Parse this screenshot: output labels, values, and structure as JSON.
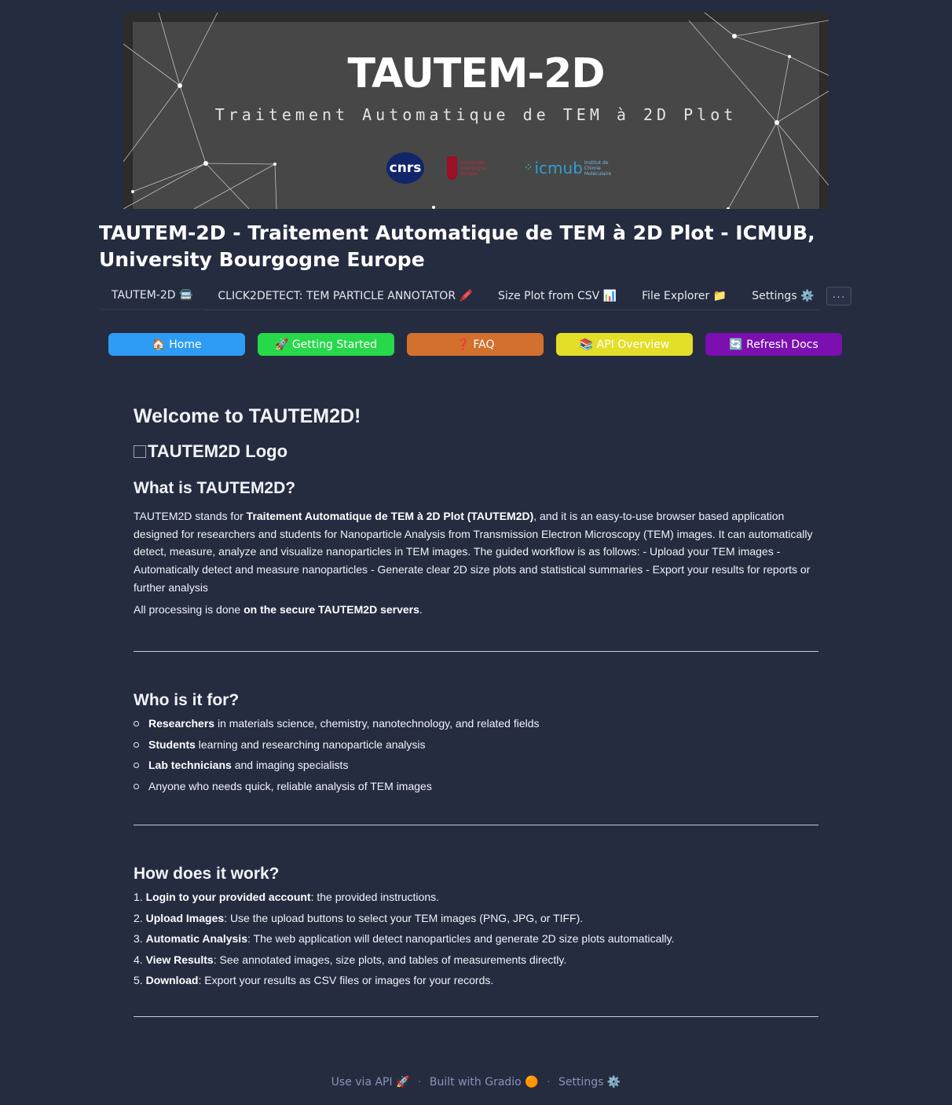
{
  "banner": {
    "title": "TAUTEM-2D",
    "subtitle": "Traitement Automatique de TEM à 2D Plot",
    "logos": {
      "cnrs": "cnrs",
      "ub": "Université Bourgogne Europe",
      "icmub": "icmub",
      "icmub_sub": "Institut de Chimie Moléculaire"
    }
  },
  "page_title": "TAUTEM-2D - Traitement Automatique de TEM à 2D Plot - ICMUB, University Bourgogne Europe",
  "tabs": [
    {
      "label": "TAUTEM-2D 🚍"
    },
    {
      "label": "CLICK2DETECT: TEM PARTICLE ANNOTATOR 🖍️"
    },
    {
      "label": "Size Plot from CSV 📊"
    },
    {
      "label": "File Explorer 📁"
    },
    {
      "label": "Settings ⚙️"
    }
  ],
  "more_label": "···",
  "buttons": [
    {
      "label": "🏠 Home",
      "color": "#2e9cf4"
    },
    {
      "label": "🚀 Getting Started",
      "color": "#27d84a"
    },
    {
      "label": "❓ FAQ",
      "color": "#d3702e"
    },
    {
      "label": "📚 API Overview",
      "color": "#e3de28"
    },
    {
      "label": "🔄 Refresh Docs",
      "color": "#7b0fb0"
    }
  ],
  "content": {
    "welcome": "Welcome to TAUTEM2D!",
    "logo_alt": "TAUTEM2D Logo",
    "what_title": "What is TAUTEM2D?",
    "what_p1_a": "TAUTEM2D stands for ",
    "what_p1_b": "Traitement Automatique de TEM à 2D Plot (TAUTEM2D)",
    "what_p1_c": ", and it is an easy-to-use browser based application designed for researchers and students for Nanoparticle Analysis from Transmission Electron Microscopy (TEM) images. It can automatically detect, measure, analyze and visualize nanoparticles in TEM images. The guided workflow is as follows: - Upload your TEM images - Automatically detect and measure nanoparticles - Generate clear 2D size plots and statistical summaries - Export your results for reports or further analysis",
    "what_p2_a": "All processing is done ",
    "what_p2_b": "on the secure TAUTEM2D servers",
    "what_p2_c": ".",
    "who_title": "Who is it for?",
    "who_items": [
      {
        "bold": "Researchers",
        "rest": " in materials science, chemistry, nanotechnology, and related fields"
      },
      {
        "bold": "Students",
        "rest": " learning and researching nanoparticle analysis"
      },
      {
        "bold": "Lab technicians",
        "rest": " and imaging specialists"
      },
      {
        "bold": "",
        "rest": "Anyone who needs quick, reliable analysis of TEM images"
      }
    ],
    "how_title": "How does it work?",
    "how_items": [
      {
        "num": "1. ",
        "bold": "Login to your provided account",
        "rest": ": the provided instructions."
      },
      {
        "num": "2. ",
        "bold": "Upload Images",
        "rest": ": Use the upload buttons to select your TEM images (PNG, JPG, or TIFF)."
      },
      {
        "num": "3. ",
        "bold": "Automatic Analysis",
        "rest": ": The web application will detect nanoparticles and generate 2D size plots automatically."
      },
      {
        "num": "4. ",
        "bold": "View Results",
        "rest": ": See annotated images, size plots, and tables of measurements directly."
      },
      {
        "num": "5. ",
        "bold": "Download",
        "rest": ": Export your results as CSV files or images for your records."
      }
    ]
  },
  "footer": {
    "api": "Use via API 🚀",
    "gradio": "Built with Gradio 🟠",
    "settings": "Settings ⚙️",
    "sep": "·"
  }
}
